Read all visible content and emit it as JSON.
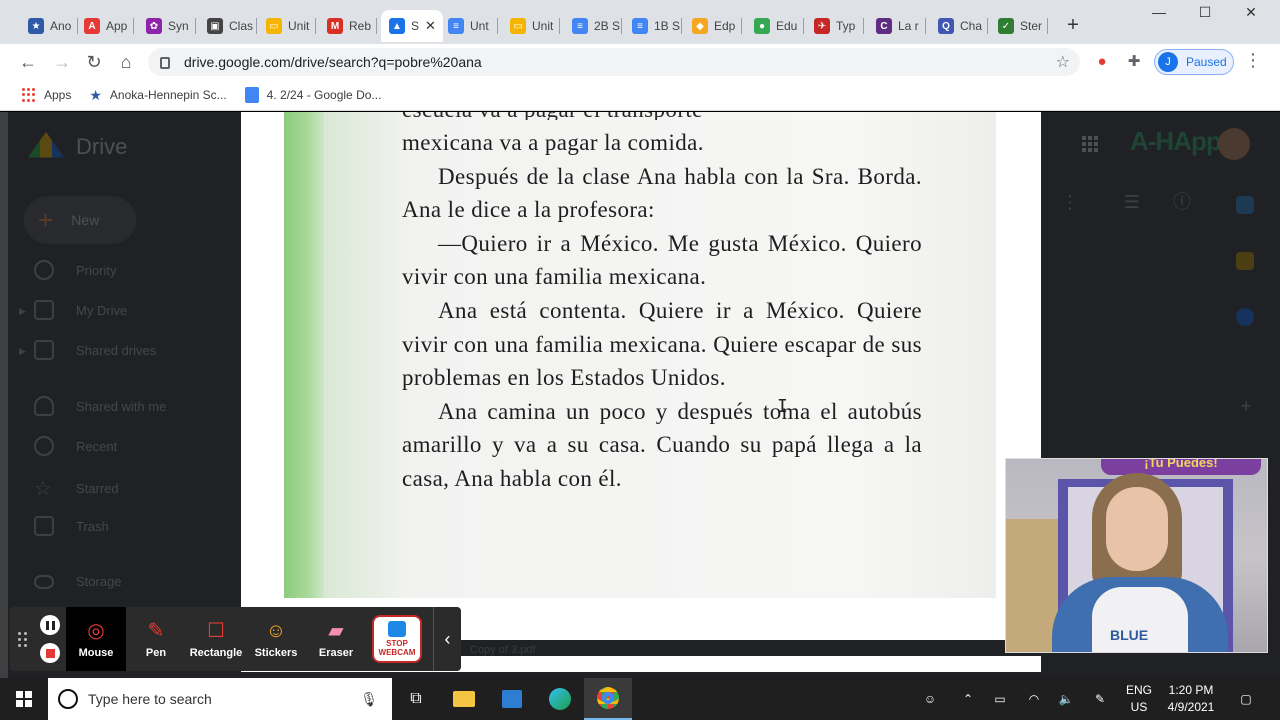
{
  "browser": {
    "tabs": [
      {
        "label": "Ano",
        "icon": "anoka-icon",
        "color": "#2e5aa8",
        "glyph": "★"
      },
      {
        "label": "App",
        "icon": "adobe-icon",
        "color": "#e53935",
        "glyph": "A"
      },
      {
        "label": "Syn",
        "icon": "pinwheel-icon",
        "color": "#8e24aa",
        "glyph": "✿"
      },
      {
        "label": "Clas",
        "icon": "classroom-icon",
        "color": "#444",
        "glyph": "▣"
      },
      {
        "label": "Unit",
        "icon": "slides-icon",
        "color": "#f4b400",
        "glyph": "▭"
      },
      {
        "label": "Reb",
        "icon": "gmail-icon",
        "color": "#d93025",
        "glyph": "M"
      },
      {
        "label": "S",
        "icon": "drive-icon",
        "color": "#1a73e8",
        "glyph": "▲",
        "active": true
      },
      {
        "label": "Unt",
        "icon": "docs-icon",
        "color": "#4285f4",
        "glyph": "≡"
      },
      {
        "label": "Unit",
        "icon": "slides-icon",
        "color": "#f4b400",
        "glyph": "▭"
      },
      {
        "label": "2B S",
        "icon": "docs-icon",
        "color": "#4285f4",
        "glyph": "≡"
      },
      {
        "label": "1B S",
        "icon": "docs-icon",
        "color": "#4285f4",
        "glyph": "≡"
      },
      {
        "label": "Edp",
        "icon": "edpuzzle-icon",
        "color": "#f5a623",
        "glyph": "◆"
      },
      {
        "label": "Edu",
        "icon": "edu-icon",
        "color": "#34a853",
        "glyph": "●"
      },
      {
        "label": "Typ",
        "icon": "typing-icon",
        "color": "#c62828",
        "glyph": "✈"
      },
      {
        "label": "La r",
        "icon": "circle-c-icon",
        "color": "#5f2c82",
        "glyph": "C"
      },
      {
        "label": "Cha",
        "icon": "quizlet-icon",
        "color": "#4257b2",
        "glyph": "Q"
      },
      {
        "label": "Ster",
        "icon": "check-icon",
        "color": "#2e7d32",
        "glyph": "✓"
      }
    ],
    "url": "drive.google.com/drive/search?q=pobre%20ana",
    "profile_initial": "J",
    "profile_status": "Paused",
    "bookmarks": [
      {
        "label": "Apps",
        "icon": "apps-grid-icon"
      },
      {
        "label": "Anoka-Hennepin Sc...",
        "icon": "anoka-icon"
      },
      {
        "label": "4. 2/24 - Google Do...",
        "icon": "docs-icon"
      }
    ]
  },
  "drive": {
    "logo_text": "Drive",
    "new_label": "New",
    "nav": [
      {
        "label": "Priority",
        "icon": "priority-icon"
      },
      {
        "label": "My Drive",
        "icon": "my-drive-icon"
      },
      {
        "label": "Shared drives",
        "icon": "shared-drives-icon"
      },
      {
        "label": "Shared with me",
        "icon": "shared-with-me-icon"
      },
      {
        "label": "Recent",
        "icon": "recent-icon"
      },
      {
        "label": "Starred",
        "icon": "star-icon"
      },
      {
        "label": "Trash",
        "icon": "trash-icon"
      },
      {
        "label": "Storage",
        "icon": "cloud-icon"
      }
    ],
    "brand": "A-HApps",
    "file_name": "Copy of 3.pdf"
  },
  "document": {
    "partial_line": "escuela va a pagar el transporte",
    "paragraphs": [
      "mexicana va a pagar la comida.",
      "Después de la clase Ana habla con la Sra. Borda. Ana le dice a la profesora:",
      "—Quiero ir a México. Me gusta México. Quiero vivir con una familia mexicana.",
      "Ana está contenta. Quiere ir a México. Quiere vivir con una familia mexicana. Quiere escapar de sus problemas en los Estados Unidos.",
      "Ana camina un poco y después toma el autobús amarillo y va a su casa. Cuando su papá llega a la casa, Ana habla con él."
    ]
  },
  "screencast": {
    "tools": [
      {
        "label": "Mouse",
        "icon": "mouse-cursor-icon",
        "selected": true
      },
      {
        "label": "Pen",
        "icon": "pen-icon"
      },
      {
        "label": "Rectangle",
        "icon": "rectangle-icon"
      },
      {
        "label": "Stickers",
        "icon": "sticker-icon"
      },
      {
        "label": "Eraser",
        "icon": "eraser-icon"
      }
    ],
    "webcam_button": "STOP WEBCAM"
  },
  "webcam": {
    "banner": "¡Tu Puedes!",
    "shirt_text": "BLUE"
  },
  "taskbar": {
    "search_placeholder": "Type here to search",
    "lang_top": "ENG",
    "lang_bottom": "US",
    "time": "1:20 PM",
    "date": "4/9/2021"
  }
}
